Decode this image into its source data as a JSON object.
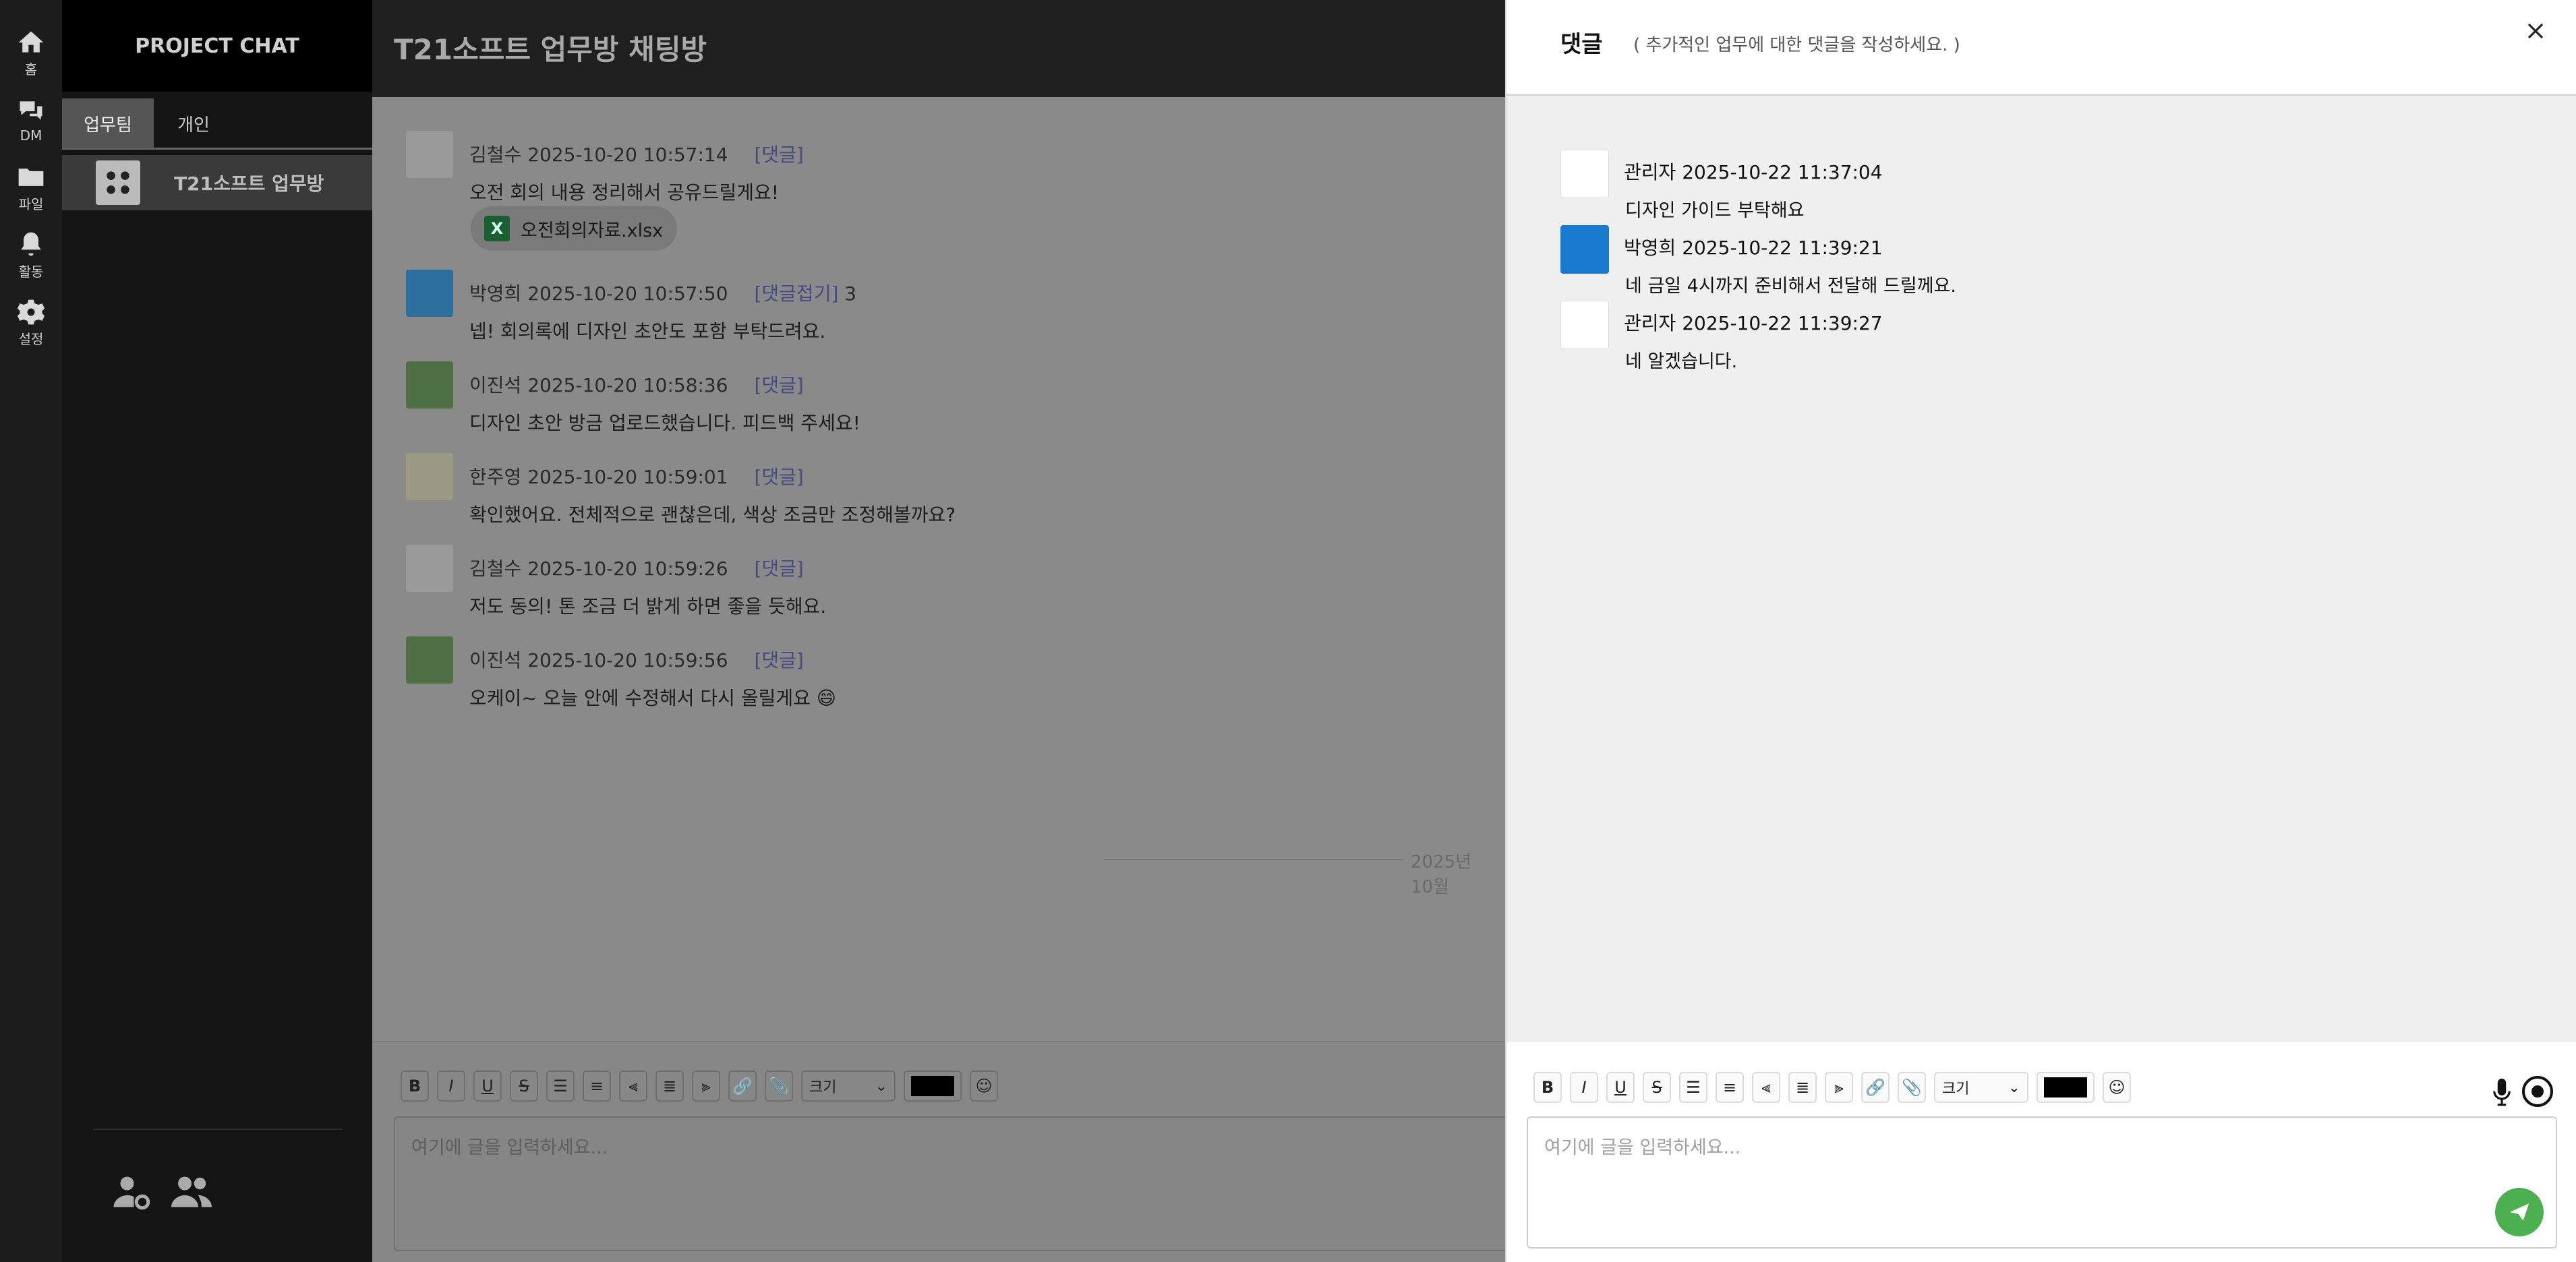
{
  "rail": {
    "items": [
      {
        "label": "홈",
        "icon": "home-icon"
      },
      {
        "label": "DM",
        "icon": "chat-bubbles-icon"
      },
      {
        "label": "파일",
        "icon": "folder-icon"
      },
      {
        "label": "활동",
        "icon": "bell-icon"
      },
      {
        "label": "설정",
        "icon": "gear-icon"
      }
    ]
  },
  "sidebar": {
    "brand": "PROJECT CHAT",
    "tabs": [
      "업무팀",
      "개인"
    ],
    "channels": [
      {
        "name": "T21소프트 업무방"
      }
    ]
  },
  "chat": {
    "title": "T21소프트 업무방 채팅방",
    "messages": [
      {
        "author": "김철수",
        "time": "2025-10-20 10:57:14",
        "action": "[댓글]",
        "count": "",
        "text": "오전 회의 내용 정리해서 공유드릴게요!",
        "file": "오전회의자료.xlsx"
      },
      {
        "author": "박영희",
        "time": "2025-10-20 10:57:50",
        "action": "[댓글접기]",
        "count": "3",
        "text": "넵! 회의록에 디자인 초안도 포함 부탁드려요."
      },
      {
        "author": "이진석",
        "time": "2025-10-20 10:58:36",
        "action": "[댓글]",
        "count": "",
        "text": "디자인 초안 방금 업로드했습니다. 피드백 주세요!"
      },
      {
        "author": "한주영",
        "time": "2025-10-20 10:59:01",
        "action": "[댓글]",
        "count": "",
        "text": "확인했어요. 전체적으로 괜찮은데, 색상 조금만 조정해볼까요?"
      },
      {
        "author": "김철수",
        "time": "2025-10-20 10:59:26",
        "action": "[댓글]",
        "count": "",
        "text": "저도 동의! 톤 조금 더 밝게 하면 좋을 듯해요."
      },
      {
        "author": "이진석",
        "time": "2025-10-20 10:59:56",
        "action": "[댓글]",
        "count": "",
        "text": "오케이~ 오늘 안에 수정해서 다시 올릴게요 😄"
      }
    ],
    "date_divider": "2025년 10월",
    "editor": {
      "placeholder": "여기에 글을 입력하세요...",
      "size_label": "크기"
    }
  },
  "panel": {
    "title": "댓글",
    "subtitle": "( 추가적인 업무에 대한 댓글을 작성하세요. )",
    "comments": [
      {
        "author": "관리자",
        "time": "2025-10-22 11:37:04",
        "text": "디자인 가이드 부탁해요"
      },
      {
        "author": "박영희",
        "time": "2025-10-22 11:39:21",
        "text": "네 금일 4시까지 준비해서 전달해 드릴께요."
      },
      {
        "author": "관리자",
        "time": "2025-10-22 11:39:27",
        "text": "네 알겠습니다."
      }
    ],
    "editor": {
      "placeholder": "여기에 글을 입력하세요...",
      "size_label": "크기"
    }
  },
  "colors": {
    "send": "#4caf50",
    "link": "#464a7e",
    "panel_bg": "#efefef"
  }
}
